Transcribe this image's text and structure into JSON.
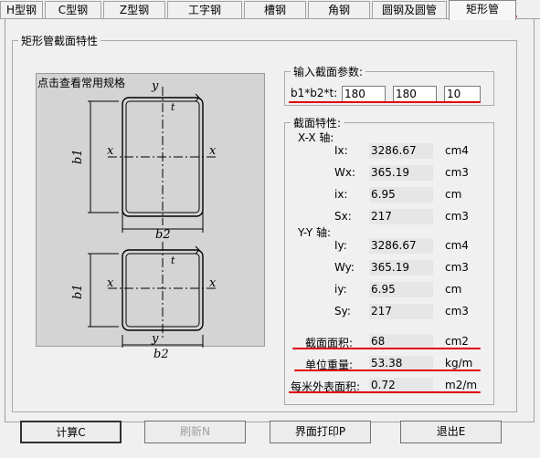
{
  "tabs": [
    {
      "label": "H型钢",
      "active": false
    },
    {
      "label": "C型钢",
      "active": false
    },
    {
      "label": "Z型钢",
      "active": false
    },
    {
      "label": "工字钢",
      "active": false
    },
    {
      "label": "槽钢",
      "active": false
    },
    {
      "label": "角钢",
      "active": false
    },
    {
      "label": "圆钢及圆管",
      "active": false
    },
    {
      "label": "矩形管",
      "active": true
    }
  ],
  "main_group": {
    "title": "矩形管截面特性"
  },
  "drawing": {
    "hint": "点击查看常用规格",
    "axis_x": "x",
    "axis_y": "y",
    "dim_b1": "b1",
    "dim_b2": "b2",
    "dim_t": "t"
  },
  "input_group": {
    "title": "输入截面参数:",
    "label": "b1*b2*t:",
    "b1": "180",
    "b2": "180",
    "t": "10"
  },
  "props_group": {
    "title": "截面特性:",
    "xx_title": "X-X 轴:",
    "xx": [
      {
        "name": "Ix:",
        "value": "3286.67",
        "unit": "cm4"
      },
      {
        "name": "Wx:",
        "value": "365.19",
        "unit": "cm3"
      },
      {
        "name": "ix:",
        "value": "6.95",
        "unit": "cm"
      },
      {
        "name": "Sx:",
        "value": "217",
        "unit": "cm3"
      }
    ],
    "yy_title": "Y-Y 轴:",
    "yy": [
      {
        "name": "Iy:",
        "value": "3286.67",
        "unit": "cm4"
      },
      {
        "name": "Wy:",
        "value": "365.19",
        "unit": "cm3"
      },
      {
        "name": "iy:",
        "value": "6.95",
        "unit": "cm"
      },
      {
        "name": "Sy:",
        "value": "217",
        "unit": "cm3"
      }
    ]
  },
  "results": {
    "area": {
      "label": "截面面积:",
      "value": "68",
      "unit": "cm2"
    },
    "weight": {
      "label": "单位重量:",
      "value": "53.38",
      "unit": "kg/m"
    },
    "surface": {
      "label": "每米外表面积:",
      "value": "0.72",
      "unit": "m2/m"
    }
  },
  "buttons": {
    "calc": "计算C",
    "refresh": "刷新N",
    "print": "界面打印P",
    "exit": "退出E"
  },
  "colors": {
    "annotation": "#e00000"
  }
}
